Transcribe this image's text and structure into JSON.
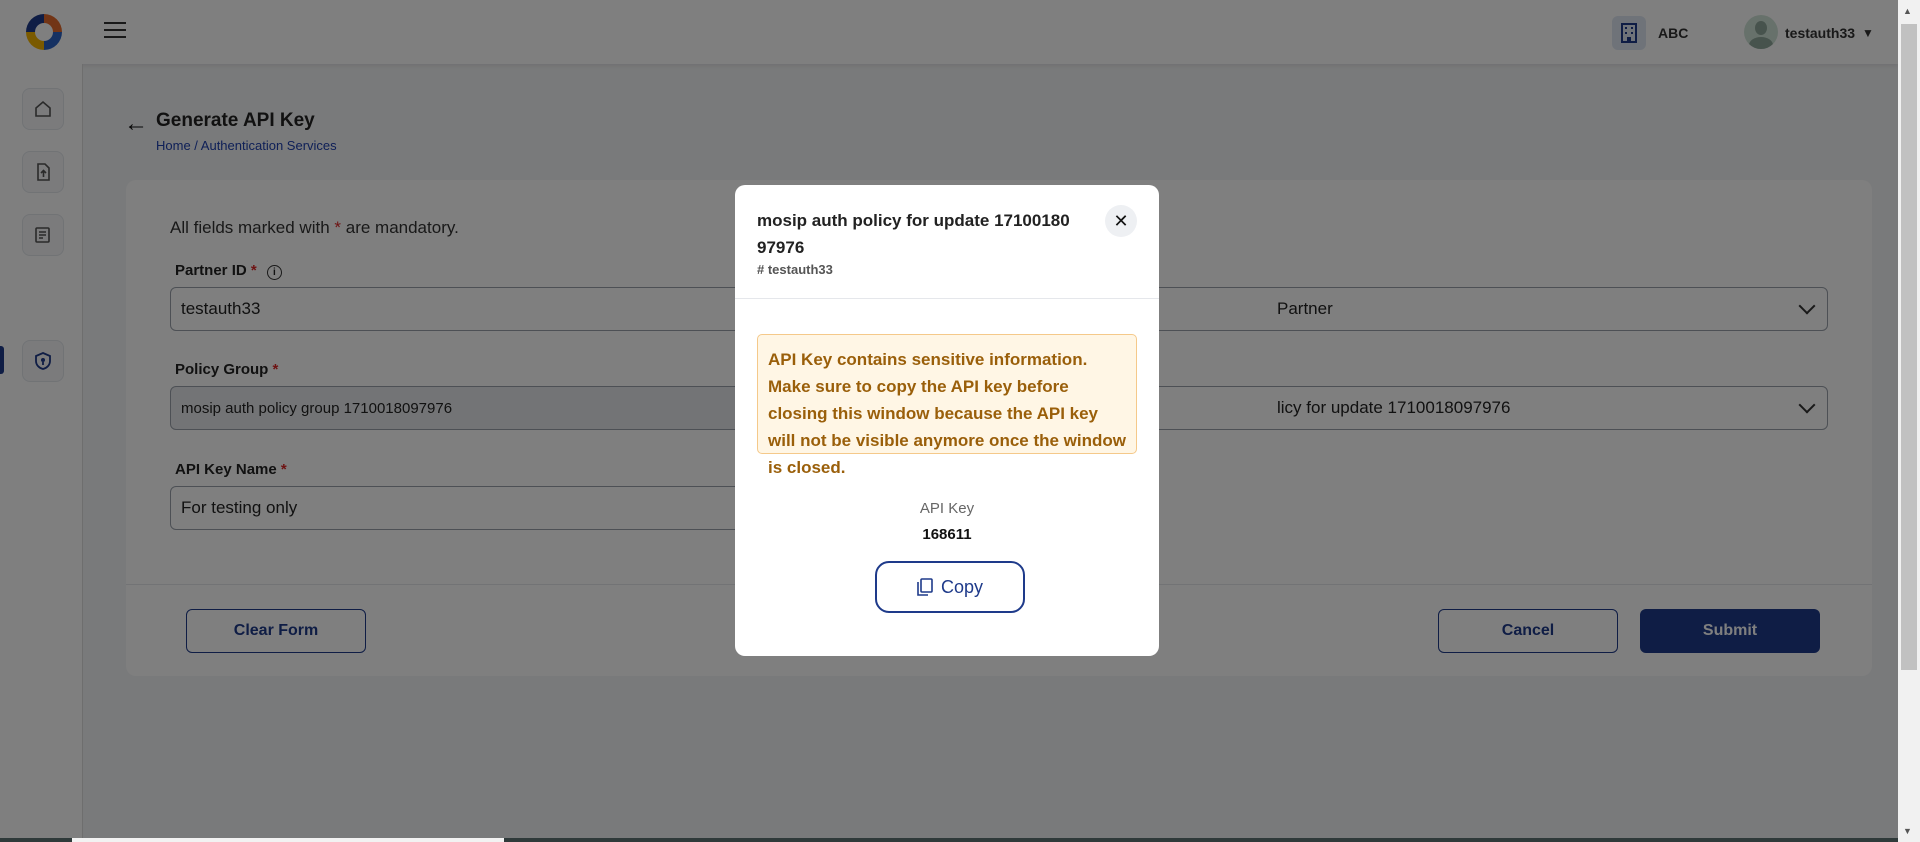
{
  "header": {
    "org_name": "ABC",
    "user_name": "testauth33",
    "icons": [
      "logo",
      "hamburger-icon",
      "building-icon",
      "avatar",
      "caret-down-icon"
    ]
  },
  "sidebar": {
    "items": [
      {
        "name": "home-icon"
      },
      {
        "name": "upload-icon"
      },
      {
        "name": "document-icon"
      },
      {
        "name": "shield-icon",
        "active": true
      }
    ]
  },
  "page": {
    "title": "Generate API Key",
    "breadcrumb": "Home / Authentication Services"
  },
  "form": {
    "mandatory_prefix": "All fields marked with ",
    "mandatory_star": "*",
    "mandatory_suffix": " are mandatory.",
    "partner_id_label": "Partner ID",
    "partner_id_value": "testauth33",
    "partner_type_value": "Partner",
    "policy_group_label": "Policy Group",
    "policy_group_value": "mosip auth policy group 1710018097976",
    "policy_name_value": "licy for update 1710018097976",
    "api_key_name_label": "API Key Name",
    "api_key_name_value": "For testing only",
    "required_star": "*"
  },
  "buttons": {
    "clear_form": "Clear Form",
    "cancel": "Cancel",
    "submit": "Submit"
  },
  "modal": {
    "title": "mosip auth policy for update 17100180 97976",
    "subtitle": "# testauth33",
    "warning": "API Key contains sensitive information. Make sure to copy the API key before closing this window because the API key will not be visible anymore once the window is closed.",
    "api_key_label": "API Key",
    "api_key_value": "168611",
    "copy_label": "Copy"
  },
  "colors": {
    "primary": "#1e3a8a",
    "warning_bg": "#fff6e5",
    "warning_text": "#9a5f0a",
    "required": "#dc2626"
  }
}
